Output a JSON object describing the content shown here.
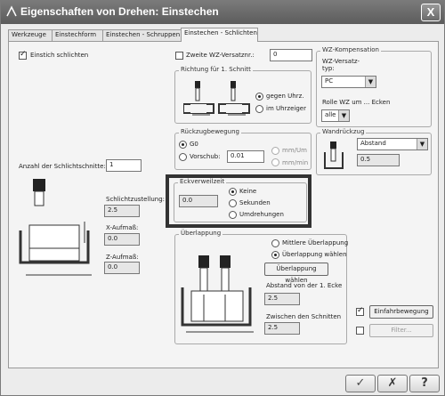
{
  "window": {
    "title": "Eigenschaften von Drehen: Einstechen",
    "close_label": "X"
  },
  "tabs": [
    {
      "label": "Werkzeuge"
    },
    {
      "label": "Einstechform"
    },
    {
      "label": "Einstechen - Schruppen"
    },
    {
      "label": "Einstechen - Schlichten"
    }
  ],
  "einstich": {
    "label": "Einstich schlichten",
    "checked": true
  },
  "zweite": {
    "label": "Zweite WZ-Versatznr.:",
    "value": "0"
  },
  "wzkomp": {
    "legend": "WZ-Kompensation",
    "typ_label": "WZ-Versatz-\ntyp:",
    "typ_value": "PC",
    "rolle_label": "Rolle WZ um ... Ecken",
    "rolle_value": "alle"
  },
  "richtung": {
    "legend": "Richtung für 1. Schnitt",
    "option1": "gegen Uhrz.",
    "option2": "im Uhrzeiger"
  },
  "rueckzug": {
    "legend": "Rückzugbewegung",
    "option1": "G0",
    "option2": "Vorschub:",
    "vorschub_value": "0.01",
    "unit1": "mm/Um",
    "unit2": "mm/min"
  },
  "wandrueckzug": {
    "legend": "Wandrückzug",
    "select_value": "Abstand",
    "value": "0.5"
  },
  "anzahl": {
    "label": "Anzahl der Schlichtschnitte:",
    "value": "1"
  },
  "eckverweilzeit": {
    "legend": "Eckverweilzeit",
    "value": "0.0",
    "option1": "Keine",
    "option2": "Sekunden",
    "option3": "Umdrehungen"
  },
  "schlichtzustellung": {
    "label": "Schlichtzustellung:",
    "value": "2.5"
  },
  "xaufmass": {
    "label": "X-Aufmaß:",
    "value": "0.0"
  },
  "zaufmass": {
    "label": "Z-Aufmaß:",
    "value": "0.0"
  },
  "ueberlappung": {
    "legend": "Überlappung",
    "option1": "Mittlere Überlappung",
    "option2": "Überlappung wählen",
    "button": "Überlappung wählen",
    "abstand_label": "Abstand von der 1. Ecke",
    "abstand_value": "2.5",
    "zwischen_label": "Zwischen den Schnitten",
    "zwischen_value": "2.5"
  },
  "einfahr": {
    "button": "Einfahrbewegung",
    "checked": true
  },
  "filter": {
    "button": "Filter...",
    "checked": false
  },
  "bottom": {
    "ok": "✓",
    "cancel": "✗",
    "help": "?"
  }
}
